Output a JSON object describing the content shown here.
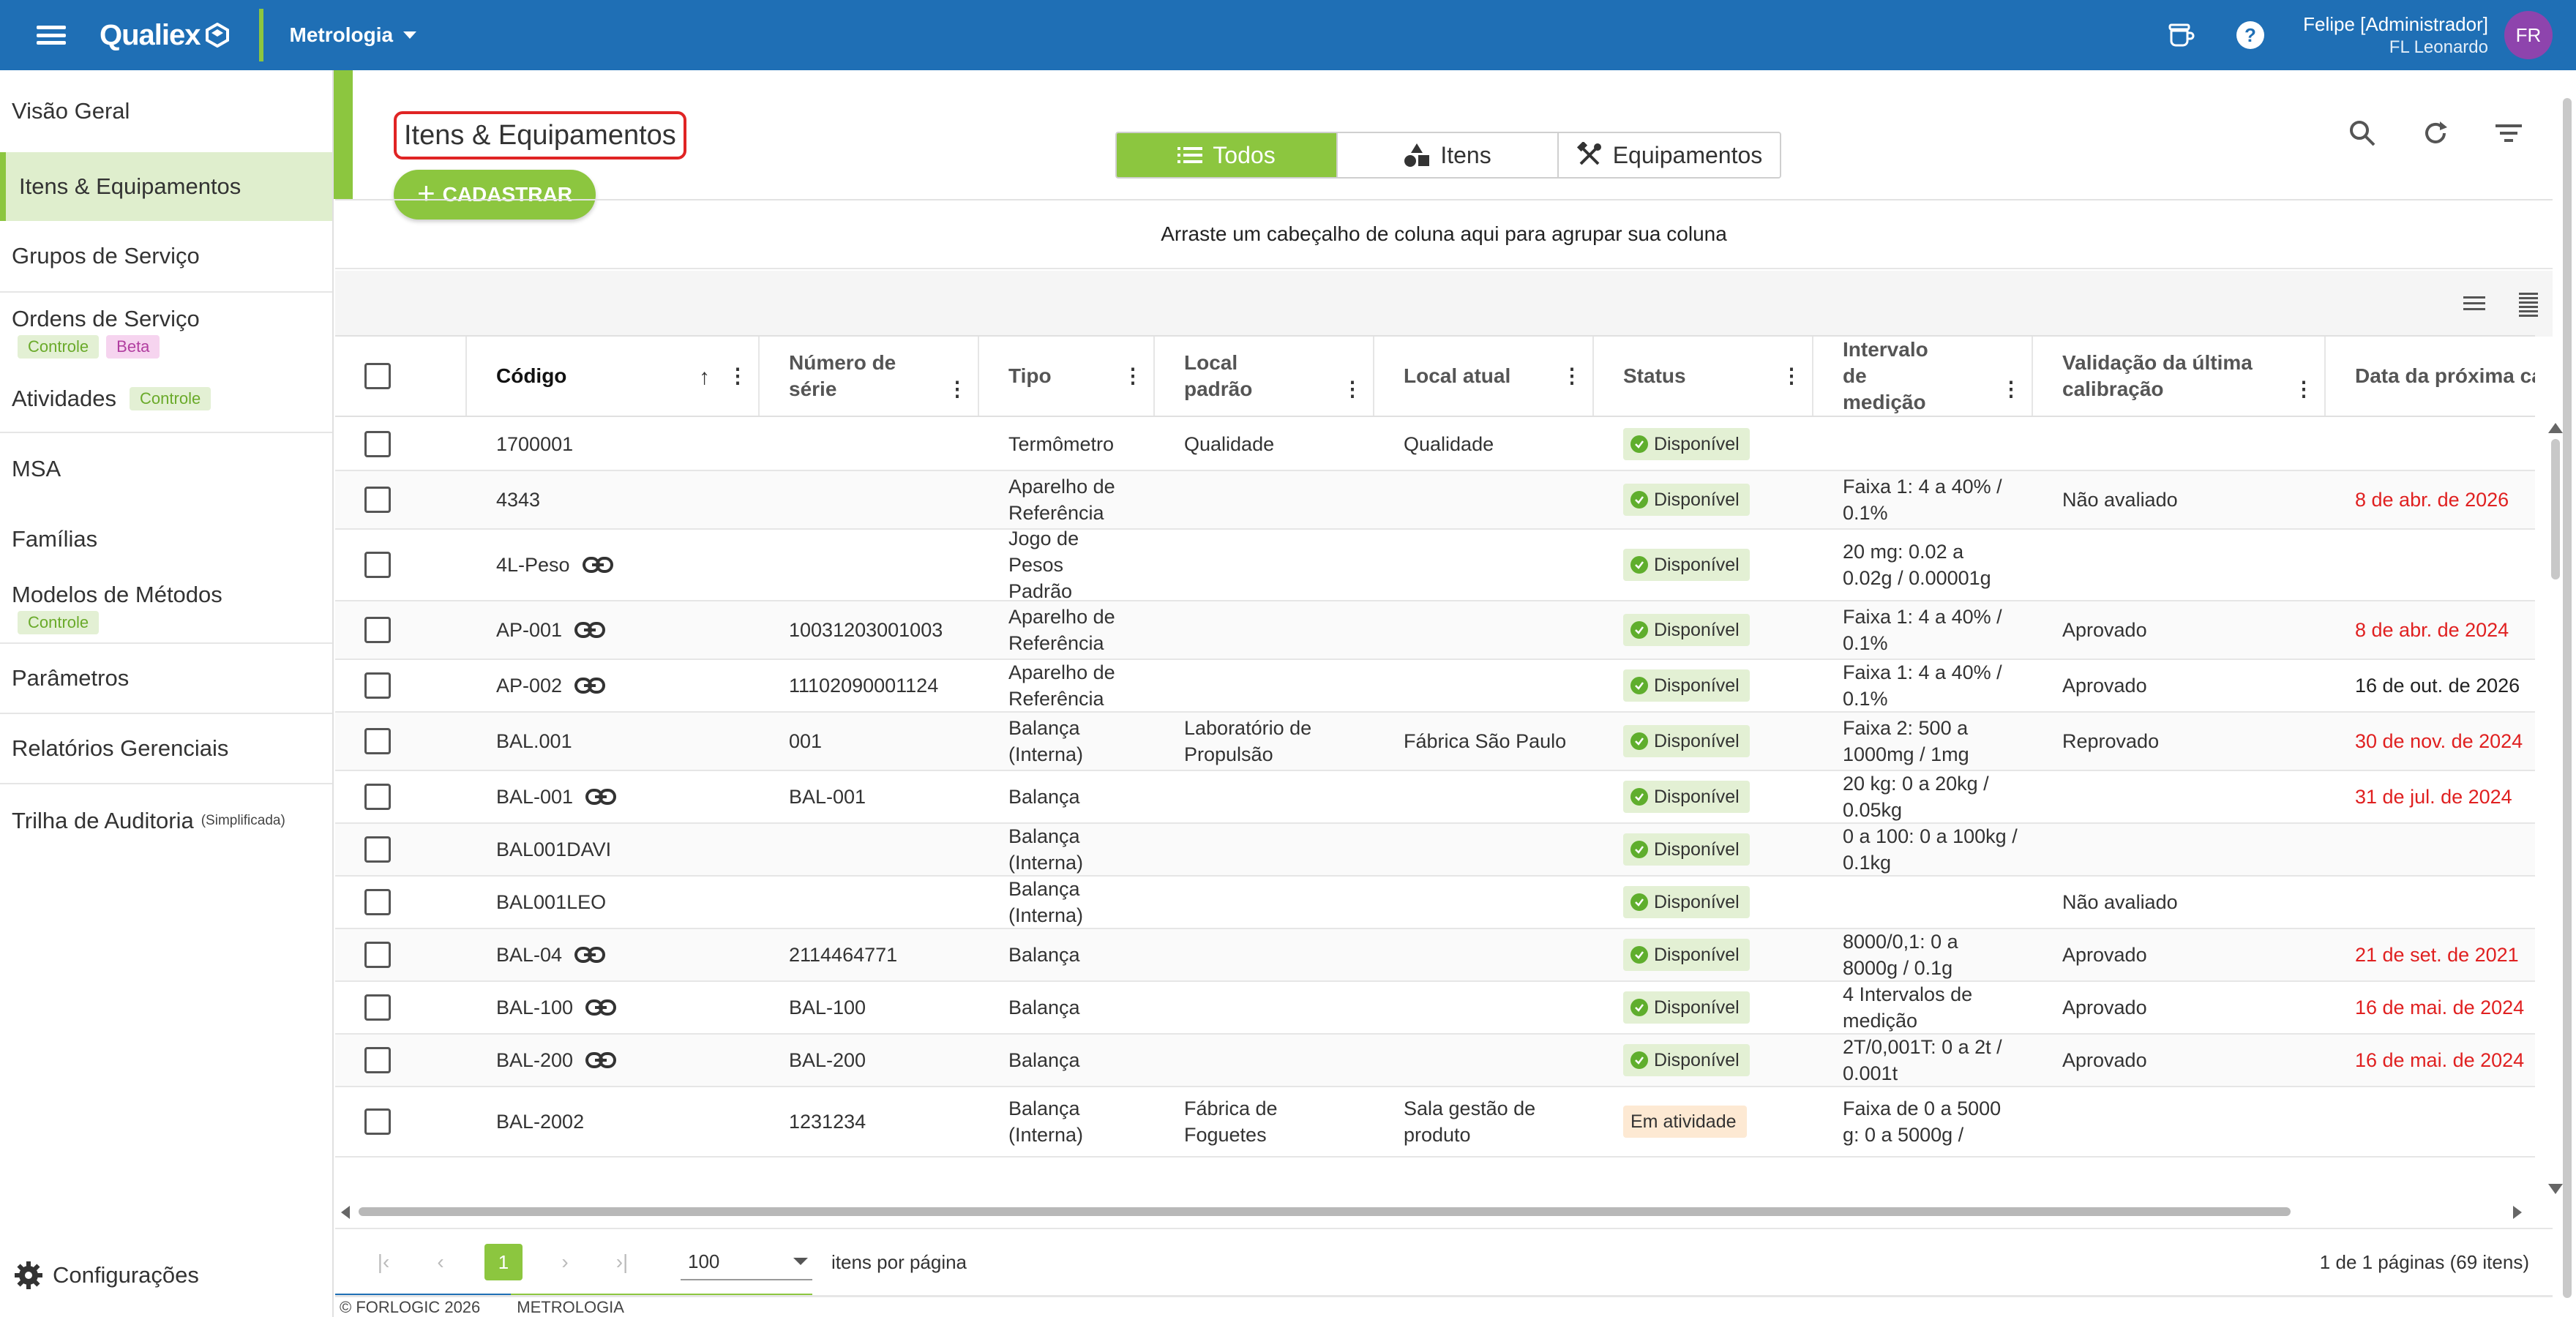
{
  "topbar": {
    "logo": "Qualiex",
    "module": "Metrologia",
    "user_name": "Felipe [Administrador]",
    "user_sub": "FL Leonardo",
    "avatar_initials": "FR",
    "icons": [
      "menu-icon",
      "coffee-cup-icon",
      "help-icon"
    ]
  },
  "sidebar": {
    "items": [
      {
        "label": "Visão Geral"
      },
      {
        "label": "Itens & Equipamentos",
        "active": true
      },
      {
        "label": "Grupos de Serviço"
      },
      {
        "label": "Ordens de Serviço",
        "badges": [
          "Controle",
          "Beta"
        ]
      },
      {
        "label": "Atividades",
        "badges": [
          "Controle"
        ]
      },
      {
        "label": "MSA"
      },
      {
        "label": "Famílias"
      },
      {
        "label": "Modelos de Métodos",
        "badges": [
          "Controle"
        ]
      },
      {
        "label": "Parâmetros"
      },
      {
        "label": "Relatórios Gerenciais"
      },
      {
        "label": "Trilha de Auditoria",
        "note": "(Simplificada)"
      }
    ],
    "settings_label": "Configurações"
  },
  "main": {
    "title": "Itens & Equipamentos",
    "cadastrar_label": "CADASTRAR",
    "tabs": [
      {
        "label": "Todos",
        "icon": "list-icon",
        "active": true
      },
      {
        "label": "Itens",
        "icon": "shapes-icon"
      },
      {
        "label": "Equipamentos",
        "icon": "tools-icon"
      }
    ],
    "group_hint": "Arraste um cabeçalho de coluna aqui para agrupar sua coluna"
  },
  "grid": {
    "columns": [
      "Código",
      "Número de série",
      "Tipo",
      "Local padrão",
      "Local atual",
      "Status",
      "Intervalo de medição",
      "Validação da última calibração",
      "Data da próxima ca"
    ],
    "rows": [
      {
        "code": "1700001",
        "serial": "",
        "type": "Termômetro",
        "local_padrao": "Qualidade",
        "local_atual": "Qualidade",
        "status": "Disponível",
        "interval": "",
        "validation": "",
        "next_date": "",
        "date_color": "black",
        "link": false
      },
      {
        "code": "4343",
        "serial": "",
        "type": "Aparelho de Referência",
        "local_padrao": "",
        "local_atual": "",
        "status": "Disponível",
        "interval": "Faixa 1: 4 a 40% / 0.1%",
        "validation": "Não avaliado",
        "next_date": "8 de abr. de 2026",
        "date_color": "red",
        "link": false
      },
      {
        "code": "4L-Peso",
        "serial": "",
        "type": "Jogo de Pesos Padrão",
        "local_padrao": "",
        "local_atual": "",
        "status": "Disponível",
        "interval": "20 mg: 0.02 a 0.02g / 0.00001g",
        "validation": "",
        "next_date": "",
        "date_color": "black",
        "link": true
      },
      {
        "code": "AP-001",
        "serial": "10031203001003",
        "type": "Aparelho de Referência",
        "local_padrao": "",
        "local_atual": "",
        "status": "Disponível",
        "interval": "Faixa 1: 4 a 40% / 0.1%",
        "validation": "Aprovado",
        "next_date": "8 de abr. de 2024",
        "date_color": "red",
        "link": true
      },
      {
        "code": "AP-002",
        "serial": "11102090001124",
        "type": "Aparelho de Referência",
        "local_padrao": "",
        "local_atual": "",
        "status": "Disponível",
        "interval": "Faixa 1: 4 a 40% / 0.1%",
        "validation": "Aprovado",
        "next_date": "16 de out. de 2026",
        "date_color": "black",
        "link": true
      },
      {
        "code": "BAL.001",
        "serial": "001",
        "type": "Balança (Interna)",
        "local_padrao": "Laboratório de Propulsão",
        "local_atual": "Fábrica São Paulo",
        "status": "Disponível",
        "interval": "Faixa 2: 500 a 1000mg / 1mg",
        "validation": "Reprovado",
        "next_date": "30 de nov. de 2024",
        "date_color": "red",
        "link": false
      },
      {
        "code": "BAL-001",
        "serial": "BAL-001",
        "type": "Balança",
        "local_padrao": "",
        "local_atual": "",
        "status": "Disponível",
        "interval": "20 kg: 0 a 20kg / 0.05kg",
        "validation": "",
        "next_date": "31 de jul. de 2024",
        "date_color": "red",
        "link": true
      },
      {
        "code": "BAL001DAVI",
        "serial": "",
        "type": "Balança (Interna)",
        "local_padrao": "",
        "local_atual": "",
        "status": "Disponível",
        "interval": "0 a 100: 0 a 100kg / 0.1kg",
        "validation": "",
        "next_date": "",
        "date_color": "black",
        "link": false
      },
      {
        "code": "BAL001LEO",
        "serial": "",
        "type": "Balança (Interna)",
        "local_padrao": "",
        "local_atual": "",
        "status": "Disponível",
        "interval": "",
        "validation": "Não avaliado",
        "next_date": "",
        "date_color": "black",
        "link": false
      },
      {
        "code": "BAL-04",
        "serial": "2114464771",
        "type": "Balança",
        "local_padrao": "",
        "local_atual": "",
        "status": "Disponível",
        "interval": "8000/0,1: 0 a 8000g / 0.1g",
        "validation": "Aprovado",
        "next_date": "21 de set. de 2021",
        "date_color": "red",
        "link": true
      },
      {
        "code": "BAL-100",
        "serial": "BAL-100",
        "type": "Balança",
        "local_padrao": "",
        "local_atual": "",
        "status": "Disponível",
        "interval": "4 Intervalos de medição",
        "validation": "Aprovado",
        "next_date": "16 de mai. de 2024",
        "date_color": "red",
        "link": true
      },
      {
        "code": "BAL-200",
        "serial": "BAL-200",
        "type": "Balança",
        "local_padrao": "",
        "local_atual": "",
        "status": "Disponível",
        "interval": "2T/0,001T: 0 a 2t / 0.001t",
        "validation": "Aprovado",
        "next_date": "16 de mai. de 2024",
        "date_color": "red",
        "link": true
      },
      {
        "code": "BAL-2002",
        "serial": "1231234",
        "type": "Balança (Interna)",
        "local_padrao": "Fábrica de Foguetes",
        "local_atual": "Sala gestão de produto",
        "status": "Em atividade",
        "interval": "Faixa de 0 a 5000 g: 0 a 5000g /",
        "validation": "",
        "next_date": "",
        "date_color": "black",
        "link": false
      }
    ]
  },
  "pager": {
    "current_page": "1",
    "page_size": "100",
    "page_size_label": "itens por página",
    "info": "1 de 1 páginas (69 itens)"
  },
  "footer": {
    "copyright": "© FORLOGIC 2026",
    "module": "METROLOGIA"
  }
}
